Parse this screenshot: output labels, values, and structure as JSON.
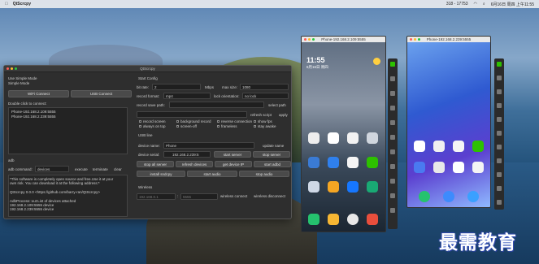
{
  "menubar": {
    "app": "QtScrcpy",
    "status": "318 - 17753",
    "datetime": "6月16日 周四 上午11:55"
  },
  "main_window": {
    "title": "QtScrcpy",
    "use_simple_mode": "Use Simple Mode",
    "simple_mode": "Simple Mode",
    "wifi_connect": "WiFi Connect",
    "usb_connect": "USB Connect",
    "double_click": "Double click to connect:",
    "devices": [
      "Phone-192.168.2.109:5555",
      "Phone-192.168.2.239:5555"
    ],
    "adb_label": "adb",
    "adb_command_label": "adb command:",
    "adb_command_value": "devices",
    "execute": "execute",
    "terminate": "terminate",
    "clear": "clear",
    "log_lines": [
      "*This software is completely open source and free.Use it at your",
      "own risk. You can download it at the following address:*",
      "",
      "QtScrcpy 0.0.0 <https://github.com/barry-ran/QtScrcpy>",
      "",
      "AdbProcess::out:List of devices attached",
      "192.168.2.109:5555        device",
      "192.168.2.239:5555        device"
    ],
    "start_config": "Start Config",
    "bit_rate_label": "bit rate:",
    "bit_rate_value": "2",
    "bit_rate_unit": "Mbps",
    "max_size_label": "max size:",
    "max_size_value": "1080",
    "record_format_label": "record format:",
    "record_format_value": "mp4",
    "lock_orientation_label": "lock orientation:",
    "lock_orientation_value": "no lock",
    "record_save_path": "record save path:",
    "select_path": "select path",
    "refresh_script": "refresh script",
    "apply": "apply",
    "options": [
      "record screen",
      "background record",
      "reverse connection",
      "show fps",
      "always on top",
      "screen-off",
      "frameless",
      "stay awake"
    ],
    "usb_line": "USB line",
    "device_name_label": "device name:",
    "device_name_value": "Phone",
    "update_name": "update name",
    "device_serial_label": "device serial:",
    "device_serial_value": "192.168.2.239:5",
    "start_server": "start server",
    "stop_server": "stop server",
    "stop_all_server": "stop all server",
    "refresh_devices": "refresh devices",
    "get_device_ip": "get device IP",
    "start_adbd": "start adbd",
    "install_sndcpy": "install sndcpy",
    "start_audio": "start audio",
    "stop_audio": "stop audio",
    "wireless": "Wireless",
    "wireless_ip": "192.168.0.1",
    "wireless_port": "5555",
    "wireless_connect": "wireless connect",
    "wireless_disconnect": "wireless disconnect"
  },
  "phone1": {
    "title": "Phone-192.168.2.109:5555",
    "time": "11:55",
    "date": "6月16日 周四"
  },
  "phone2": {
    "title": "Phone-192.168.2.239:5555"
  },
  "watermark": "最需教育",
  "colors": {
    "close": "#ff5f57",
    "minimize": "#febc2e",
    "maximize": "#28c840",
    "window_bg": "#2e2e2e",
    "accent": "#3a5fc8"
  }
}
